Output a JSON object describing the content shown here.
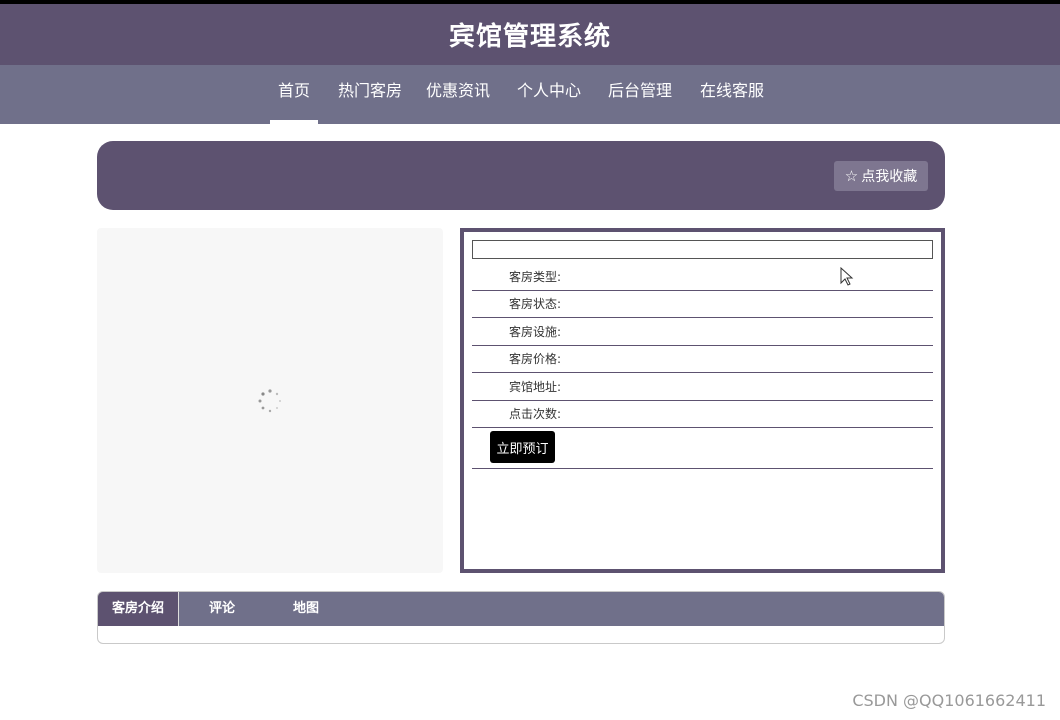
{
  "app": {
    "title": "宾馆管理系统"
  },
  "nav": {
    "items": [
      {
        "label": "首页",
        "active": true
      },
      {
        "label": "热门客房",
        "active": false
      },
      {
        "label": "优惠资讯",
        "active": false
      },
      {
        "label": "个人中心",
        "active": false
      },
      {
        "label": "后台管理",
        "active": false
      },
      {
        "label": "在线客服",
        "active": false
      }
    ]
  },
  "banner": {
    "favorite_icon": "star-outline-icon",
    "favorite_label": "点我收藏"
  },
  "room": {
    "name": "",
    "fields": [
      {
        "label": "客房类型:",
        "value": ""
      },
      {
        "label": "客房状态:",
        "value": ""
      },
      {
        "label": "客房设施:",
        "value": ""
      },
      {
        "label": "客房价格:",
        "value": ""
      },
      {
        "label": "宾馆地址:",
        "value": ""
      },
      {
        "label": "点击次数:",
        "value": ""
      }
    ],
    "book_label": "立即预订"
  },
  "tabs": {
    "items": [
      {
        "label": "客房介绍",
        "active": true
      },
      {
        "label": "评论",
        "active": false
      },
      {
        "label": "地图",
        "active": false
      }
    ]
  },
  "watermark": "CSDN @QQ1061662411",
  "colors": {
    "primary": "#5d5270",
    "secondary": "#70708a",
    "button_dark": "#000000"
  }
}
